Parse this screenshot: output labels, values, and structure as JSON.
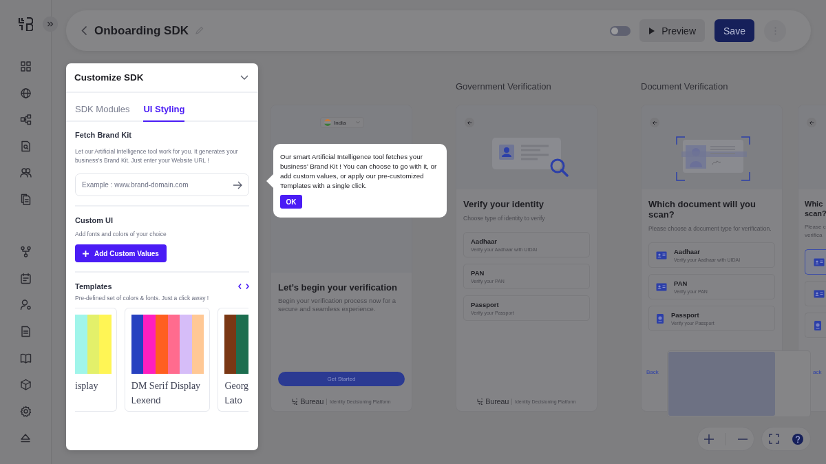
{
  "header": {
    "title": "Onboarding SDK",
    "toggle": {
      "on": false
    },
    "preview": "Preview",
    "save": "Save"
  },
  "panel": {
    "title": "Customize SDK",
    "tabs": [
      {
        "label": "SDK Modules",
        "selected": false
      },
      {
        "label": "UI Styling",
        "selected": true
      }
    ],
    "brand_kit": {
      "heading": "Fetch Brand Kit",
      "description": "Let our Artificial Intelligence tool work for you. It generates your business’s Brand Kit. Just enter your Website URL !",
      "placeholder": "Example : www.brand-domain.com"
    },
    "custom_ui": {
      "heading": "Custom UI",
      "description": "Add fonts and colors of your choice",
      "button": "Add Custom Values"
    },
    "templates": {
      "heading": "Templates",
      "description": "Pre-defined set of colors & fonts. Just a click away !",
      "items": [
        {
          "title": "isplay",
          "swatches": [
            {
              "color": "#a0f5ea"
            },
            {
              "color": "#e3f06a"
            },
            {
              "color": "#fff555"
            }
          ]
        },
        {
          "title": "DM Serif Display",
          "subtitle": "Lexend",
          "swatches": [
            {
              "color": "#2741c0"
            },
            {
              "color": "#ff1fbf"
            },
            {
              "color": "#ff5f20"
            },
            {
              "color": "#ff6b8e"
            },
            {
              "color": "#d6bdf8"
            },
            {
              "color": "#ffc895"
            }
          ]
        },
        {
          "title": "Georg",
          "subtitle": "Lato",
          "swatches": [
            {
              "color": "#7a3714"
            },
            {
              "color": "#1c6e4f"
            }
          ]
        }
      ]
    }
  },
  "tooltip": {
    "text": "Our smart Artificial Intelligence tool fetches your business’ Brand Kit ! You can choose to go with it, or add custom values, or apply our pre-customized Templates with a single click.",
    "button": "OK"
  },
  "canvas": {
    "cards": [
      {
        "kind": "welcome",
        "country": "India",
        "title": "Let’s begin your verification",
        "description": "Begin your verification process now for a secure and seamless experience.",
        "button": "Get Started",
        "brand": "Bureau",
        "tagline": "Identity Decisioning Platform"
      },
      {
        "kind": "identity",
        "heading": "Government Verification",
        "title": "Verify your identity",
        "description": "Choose type of identity to verify",
        "brand": "Bureau",
        "tagline": "Identity Decisioning Platform",
        "options": [
          {
            "title": "Aadhaar",
            "subtitle": "Verify your Aadhaar with UIDAI",
            "selected": false
          },
          {
            "title": "PAN",
            "subtitle": "Verify your PAN",
            "selected": false
          },
          {
            "title": "Passport",
            "subtitle": "Verify your Passport",
            "selected": false
          }
        ]
      },
      {
        "kind": "document",
        "heading": "Document Verification",
        "title": "Which document will you scan?",
        "description": "Please choose a document type for verification.",
        "back": "Back",
        "options": [
          {
            "title": "Aadhaar",
            "subtitle": "Verify your Aadhaar with UIDAI",
            "selected": false
          },
          {
            "title": "PAN",
            "subtitle": "Verify your PAN",
            "selected": false
          },
          {
            "title": "Passport",
            "subtitle": "Verify your Passport",
            "selected": false
          }
        ]
      },
      {
        "kind": "partial",
        "title": "Whic\nscan?",
        "description": "Please c\nverifica",
        "back": "ack",
        "options": [
          {
            "selected": true
          },
          {
            "selected": false
          },
          {
            "selected": false
          }
        ]
      }
    ]
  }
}
